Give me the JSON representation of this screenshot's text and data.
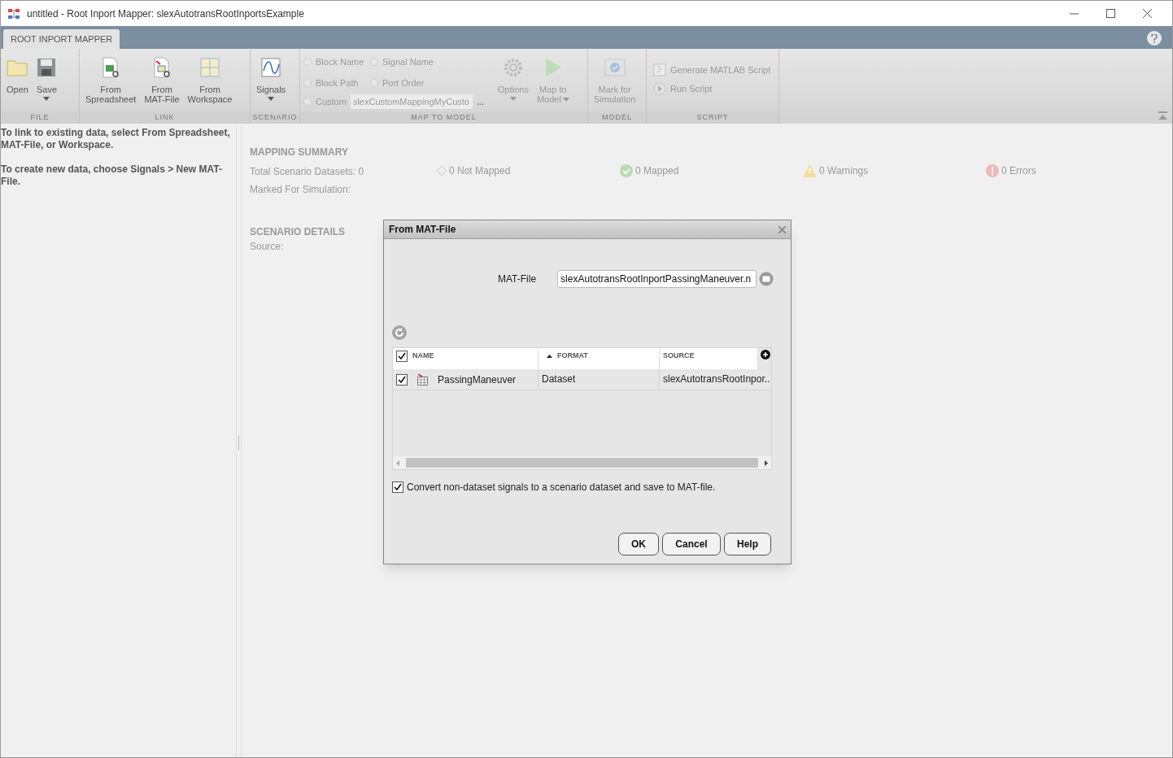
{
  "window": {
    "title": "untitled - Root Inport Mapper: slexAutotransRootInportsExample"
  },
  "tabs": [
    {
      "label": "ROOT INPORT MAPPER",
      "selected": true
    }
  ],
  "toolbar": {
    "sections": [
      {
        "label": "FILE",
        "buttons": [
          {
            "lines": [
              "Open"
            ],
            "dropdown": false,
            "disabled": false
          },
          {
            "lines": [
              "Save"
            ],
            "dropdown": true,
            "disabled": false
          }
        ]
      },
      {
        "label": "LINK",
        "buttons": [
          {
            "lines": [
              "From",
              "Spreadsheet"
            ],
            "dropdown": false,
            "disabled": false
          },
          {
            "lines": [
              "From",
              "MAT-File"
            ],
            "dropdown": false,
            "disabled": false
          },
          {
            "lines": [
              "From",
              "Workspace"
            ],
            "dropdown": false,
            "disabled": false
          }
        ]
      },
      {
        "label": "SCENARIO",
        "buttons": [
          {
            "lines": [
              "Signals"
            ],
            "dropdown": true,
            "disabled": false
          }
        ]
      },
      {
        "label": "MAP TO MODEL",
        "radios": [
          {
            "label": "Block Name",
            "selected": false,
            "disabled": true
          },
          {
            "label": "Signal Name",
            "selected": false,
            "disabled": true
          },
          {
            "label": "Block Path",
            "selected": false,
            "disabled": true
          },
          {
            "label": "Port Order",
            "selected": false,
            "disabled": true
          },
          {
            "label": "Custom",
            "selected": false,
            "disabled": true
          }
        ],
        "custom_field": {
          "value": "slexCustomMappingMyCusto",
          "browse": "..."
        },
        "buttons": [
          {
            "lines": [
              "Options"
            ],
            "dropdown": true,
            "disabled": true
          },
          {
            "lines": [
              "Map to",
              "Model"
            ],
            "dropdown": true,
            "disabled": true
          }
        ]
      },
      {
        "label": "MODEL",
        "buttons": [
          {
            "lines": [
              "Mark for",
              "Simulation"
            ],
            "dropdown": false,
            "disabled": true
          }
        ]
      },
      {
        "label": "SCRIPT",
        "small_buttons": [
          {
            "label": "Generate MATLAB Script",
            "disabled": true
          },
          {
            "label": "Run Script",
            "disabled": true
          }
        ]
      }
    ]
  },
  "left_panel": {
    "paragraphs": [
      "To link to existing data, select From Spreadsheet, MAT-File, or Workspace.",
      "To create new data, choose Signals > New MAT-File."
    ]
  },
  "mapping_summary": {
    "title": "MAPPING SUMMARY",
    "total": "Total Scenario Datasets: 0",
    "marked": "Marked For Simulation:",
    "statuses": [
      {
        "kind": "not_mapped",
        "label": "0 Not Mapped"
      },
      {
        "kind": "mapped",
        "label": "0 Mapped"
      },
      {
        "kind": "warning",
        "label": "0 Warnings"
      },
      {
        "kind": "error",
        "label": "0 Errors"
      }
    ]
  },
  "scenario_details": {
    "title": "SCENARIO DETAILS",
    "source": "Source:"
  },
  "dialog": {
    "title": "From MAT-File",
    "field_label": "MAT-File",
    "field_value": "slexAutotransRootInportPassingManeuver.n",
    "table": {
      "all_checked": true,
      "columns": [
        {
          "label": "NAME",
          "sorted": false
        },
        {
          "label": "FORMAT",
          "sorted": true
        },
        {
          "label": "SOURCE",
          "sorted": false
        }
      ],
      "rows": [
        {
          "checked": true,
          "name": "PassingManeuver",
          "format": "Dataset",
          "source": "slexAutotransRootInpor.."
        }
      ]
    },
    "convert": {
      "checked": true,
      "label": "Convert non-dataset signals to a scenario dataset and save to MAT-file."
    },
    "buttons": [
      "OK",
      "Cancel",
      "Help"
    ]
  }
}
